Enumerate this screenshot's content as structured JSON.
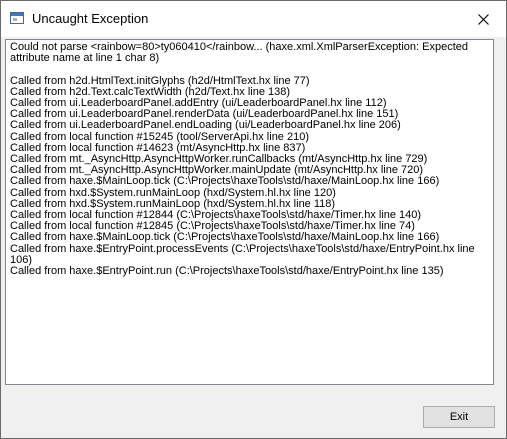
{
  "window": {
    "title": "Uncaught Exception",
    "app_icon": "window-icon",
    "close_icon": "close-icon"
  },
  "message_lines": [
    "Could not parse <rainbow=80>ty060410</rainbow... (haxe.xml.XmlParserException: Expected attribute name at line 1 char 8)",
    "",
    "Called from h2d.HtmlText.initGlyphs (h2d/HtmlText.hx line 77)",
    "Called from h2d.Text.calcTextWidth (h2d/Text.hx line 138)",
    "Called from ui.LeaderboardPanel.addEntry (ui/LeaderboardPanel.hx line 112)",
    "Called from ui.LeaderboardPanel.renderData (ui/LeaderboardPanel.hx line 151)",
    "Called from ui.LeaderboardPanel.endLoading (ui/LeaderboardPanel.hx line 206)",
    "Called from local function #15245 (tool/ServerApi.hx line 210)",
    "Called from local function #14623 (mt/AsyncHttp.hx line 837)",
    "Called from mt._AsyncHttp.AsyncHttpWorker.runCallbacks (mt/AsyncHttp.hx line 729)",
    "Called from mt._AsyncHttp.AsyncHttpWorker.mainUpdate (mt/AsyncHttp.hx line 720)",
    "Called from haxe.$MainLoop.tick (C:\\Projects\\haxeTools\\std/haxe/MainLoop.hx line 166)",
    "Called from hxd.$System.runMainLoop (hxd/System.hl.hx line 120)",
    "Called from hxd.$System.runMainLoop (hxd/System.hl.hx line 118)",
    "Called from local function #12844 (C:\\Projects\\haxeTools\\std/haxe/Timer.hx line 140)",
    "Called from local function #12845 (C:\\Projects\\haxeTools\\std/haxe/Timer.hx line 74)",
    "Called from haxe.$MainLoop.tick (C:\\Projects\\haxeTools\\std/haxe/MainLoop.hx line 166)",
    "Called from haxe.$EntryPoint.processEvents (C:\\Projects\\haxeTools\\std/haxe/EntryPoint.hx line 106)",
    "Called from haxe.$EntryPoint.run (C:\\Projects\\haxeTools\\std/haxe/EntryPoint.hx line 135)"
  ],
  "buttons": {
    "exit_label": "Exit"
  }
}
